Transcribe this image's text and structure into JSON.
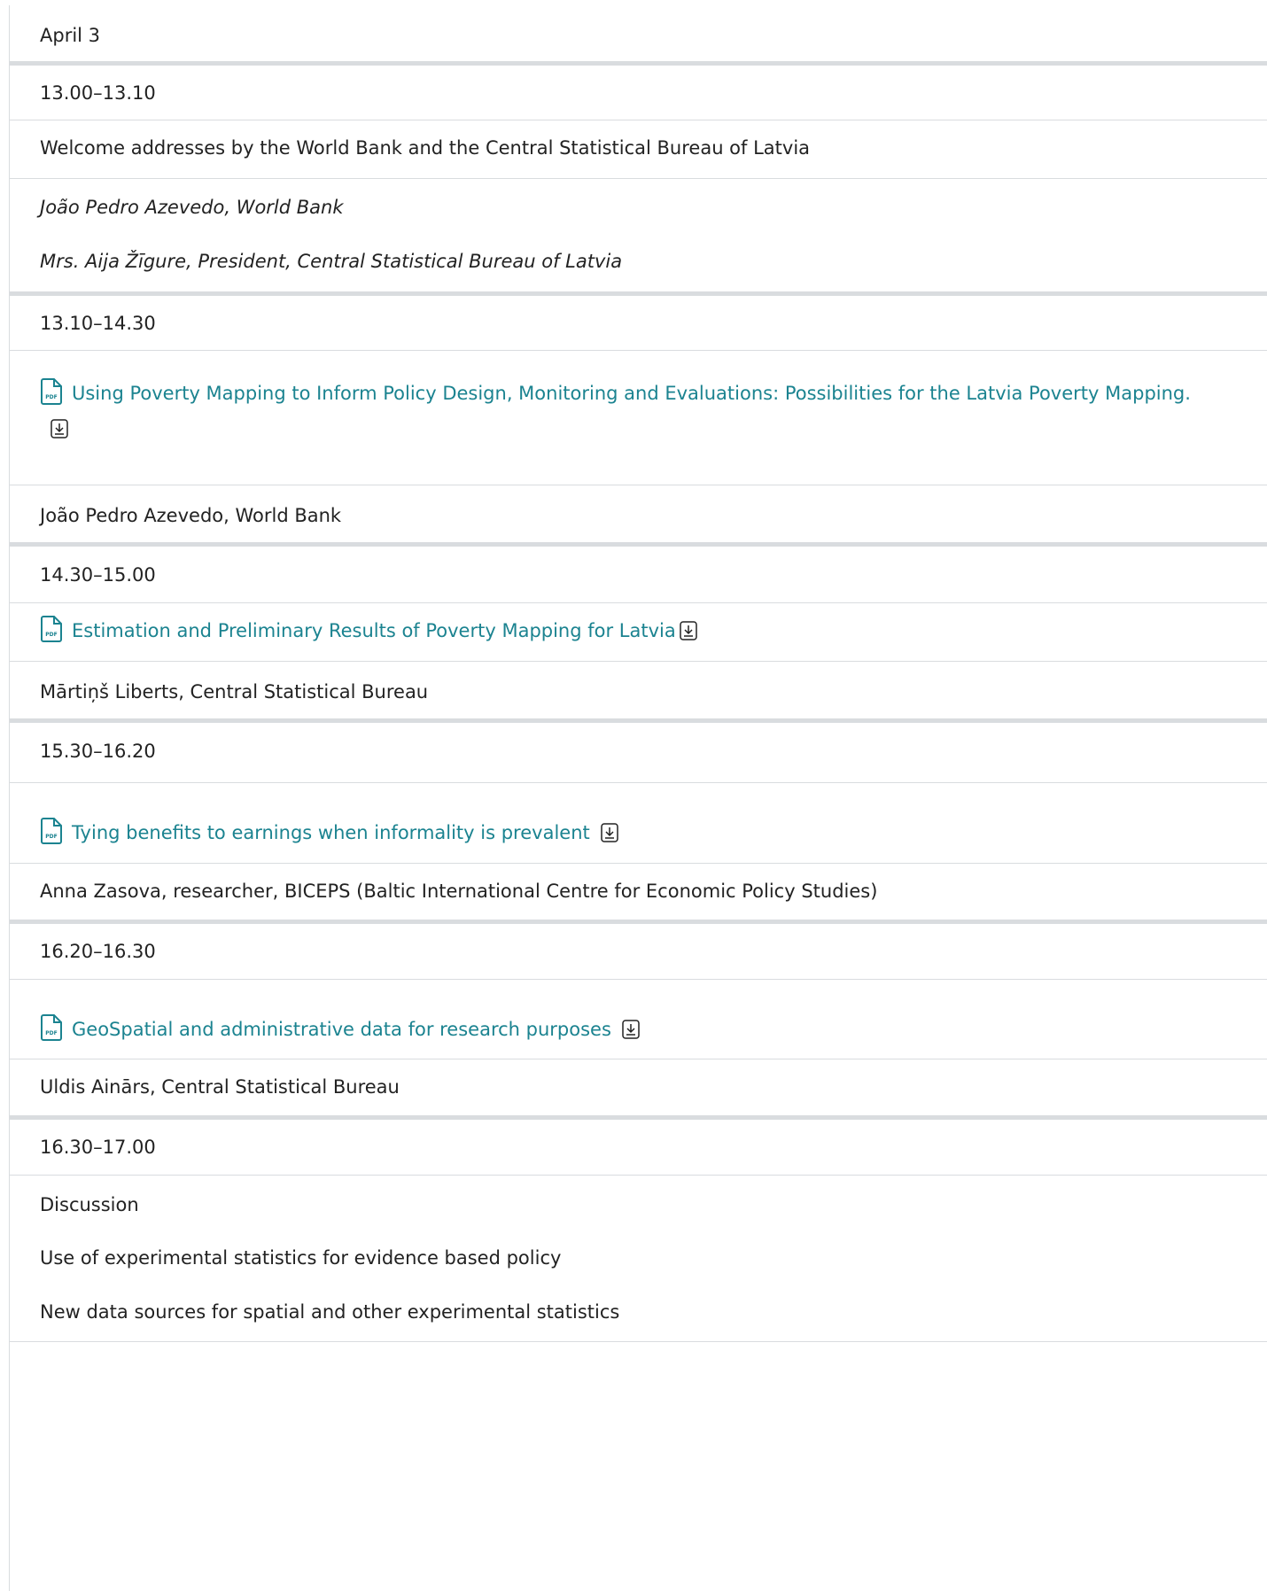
{
  "colors": {
    "link": "#1b8390",
    "text": "#222222",
    "border": "#d9dcdf"
  },
  "agenda": {
    "date": "April 3",
    "slot1": {
      "time": "13.00–13.10",
      "title": "Welcome addresses by the World Bank and the Central Statistical Bureau of Latvia",
      "speaker1": "João Pedro Azevedo, World Bank",
      "speaker2": "Mrs. Aija Žīgure, President, Central Statistical Bureau of Latvia"
    },
    "slot2": {
      "time": "13.10–14.30",
      "title": "Using Poverty Mapping to Inform Policy Design, Monitoring and Evaluations: Possibilities for the Latvia Poverty Mapping.",
      "speaker": "João Pedro Azevedo, World Bank"
    },
    "slot3": {
      "time": "14.30–15.00",
      "title": "Estimation and Preliminary Results of Poverty Mapping for Latvia",
      "speaker": "Mārtiņš Liberts, Central Statistical Bureau"
    },
    "slot4": {
      "time": "15.30–16.20",
      "title": "Tying benefits to earnings when informality is prevalent",
      "speaker": "Anna Zasova, researcher, BICEPS (Baltic International Centre for Economic Policy Studies)"
    },
    "slot5": {
      "time": "16.20–16.30",
      "title": "GeoSpatial and administrative data for research purposes",
      "speaker": "Uldis Ainārs, Central Statistical Bureau"
    },
    "slot6": {
      "time": "16.30–17.00",
      "line1": "Discussion",
      "line2": "Use of experimental statistics for evidence based policy",
      "line3": "New data sources for spatial and other experimental statistics"
    }
  }
}
